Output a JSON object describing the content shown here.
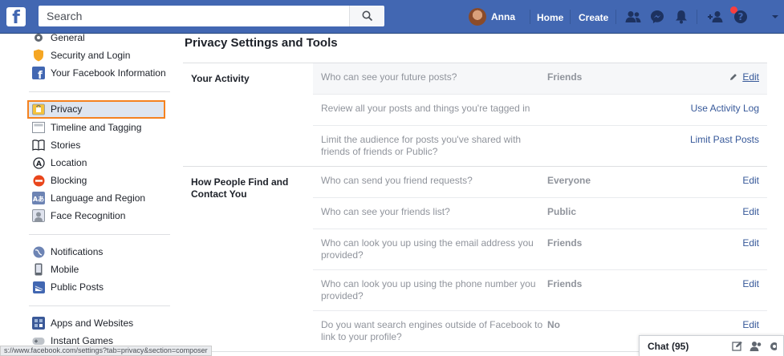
{
  "topbar": {
    "search_placeholder": "Search",
    "user_name": "Anna",
    "home": "Home",
    "create": "Create",
    "brand_color": "#4267b2"
  },
  "sidebar": {
    "items": [
      {
        "label": "General",
        "icon": "gear-icon"
      },
      {
        "label": "Security and Login",
        "icon": "shield-icon"
      },
      {
        "label": "Your Facebook Information",
        "icon": "facebook-icon"
      },
      {
        "label": "Privacy",
        "icon": "lock-icon"
      },
      {
        "label": "Timeline and Tagging",
        "icon": "timeline-icon"
      },
      {
        "label": "Stories",
        "icon": "book-icon"
      },
      {
        "label": "Location",
        "icon": "location-icon"
      },
      {
        "label": "Blocking",
        "icon": "block-icon"
      },
      {
        "label": "Language and Region",
        "icon": "language-icon"
      },
      {
        "label": "Face Recognition",
        "icon": "face-icon"
      },
      {
        "label": "Notifications",
        "icon": "globe-icon"
      },
      {
        "label": "Mobile",
        "icon": "mobile-icon"
      },
      {
        "label": "Public Posts",
        "icon": "rss-icon"
      },
      {
        "label": "Apps and Websites",
        "icon": "apps-icon"
      },
      {
        "label": "Instant Games",
        "icon": "games-icon"
      }
    ],
    "selected": "Privacy"
  },
  "main": {
    "title": "Privacy Settings and Tools",
    "sections": [
      {
        "title": "Your Activity",
        "rows": [
          {
            "question": "Who can see your future posts?",
            "value": "Friends",
            "action": "Edit"
          },
          {
            "question": "Review all your posts and things you're tagged in",
            "value": "",
            "action": "Use Activity Log"
          },
          {
            "question": "Limit the audience for posts you've shared with friends of friends or Public?",
            "value": "",
            "action": "Limit Past Posts"
          }
        ]
      },
      {
        "title": "How People Find and Contact You",
        "rows": [
          {
            "question": "Who can send you friend requests?",
            "value": "Everyone",
            "action": "Edit"
          },
          {
            "question": "Who can see your friends list?",
            "value": "Public",
            "action": "Edit"
          },
          {
            "question": "Who can look you up using the email address you provided?",
            "value": "Friends",
            "action": "Edit"
          },
          {
            "question": "Who can look you up using the phone number you provided?",
            "value": "Friends",
            "action": "Edit"
          },
          {
            "question": "Do you want search engines outside of Facebook to link to your profile?",
            "value": "No",
            "action": "Edit"
          }
        ]
      }
    ]
  },
  "statusbar": {
    "url": "s://www.facebook.com/settings?tab=privacy&section=composer"
  },
  "chat": {
    "label": "Chat (95)"
  }
}
